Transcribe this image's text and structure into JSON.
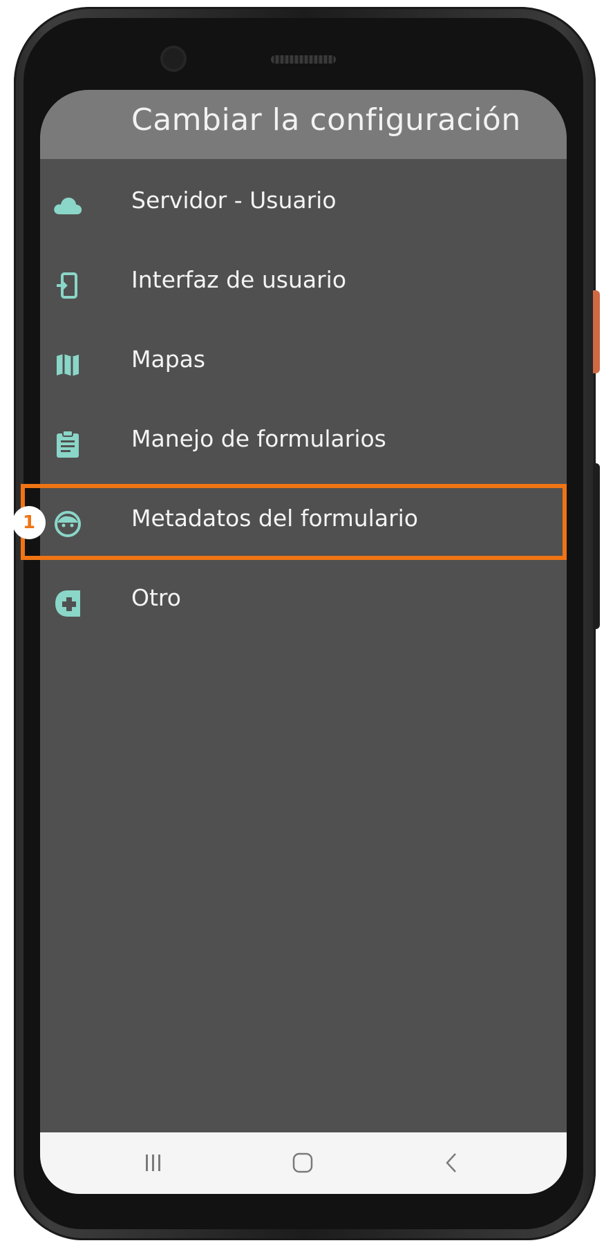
{
  "screen": {
    "title": "Cambiar la configuración"
  },
  "menu": {
    "items": [
      {
        "label": "Servidor - Usuario",
        "icon": "cloud-icon"
      },
      {
        "label": "Interfaz de usuario",
        "icon": "user-interface-icon"
      },
      {
        "label": "Mapas",
        "icon": "map-icon"
      },
      {
        "label": "Manejo de formularios",
        "icon": "clipboard-icon"
      },
      {
        "label": "Metadatos del formulario",
        "icon": "face-icon"
      },
      {
        "label": "Otro",
        "icon": "medical-plus-icon"
      }
    ]
  },
  "annotation": {
    "step_number": "1",
    "highlight_color": "#f07414"
  },
  "colors": {
    "icon_accent": "#8ad6c8",
    "background": "#505050",
    "header": "#7a7a7a"
  },
  "navigation": {
    "recents_icon": "recents-icon",
    "home_icon": "home-icon",
    "back_icon": "back-icon"
  }
}
